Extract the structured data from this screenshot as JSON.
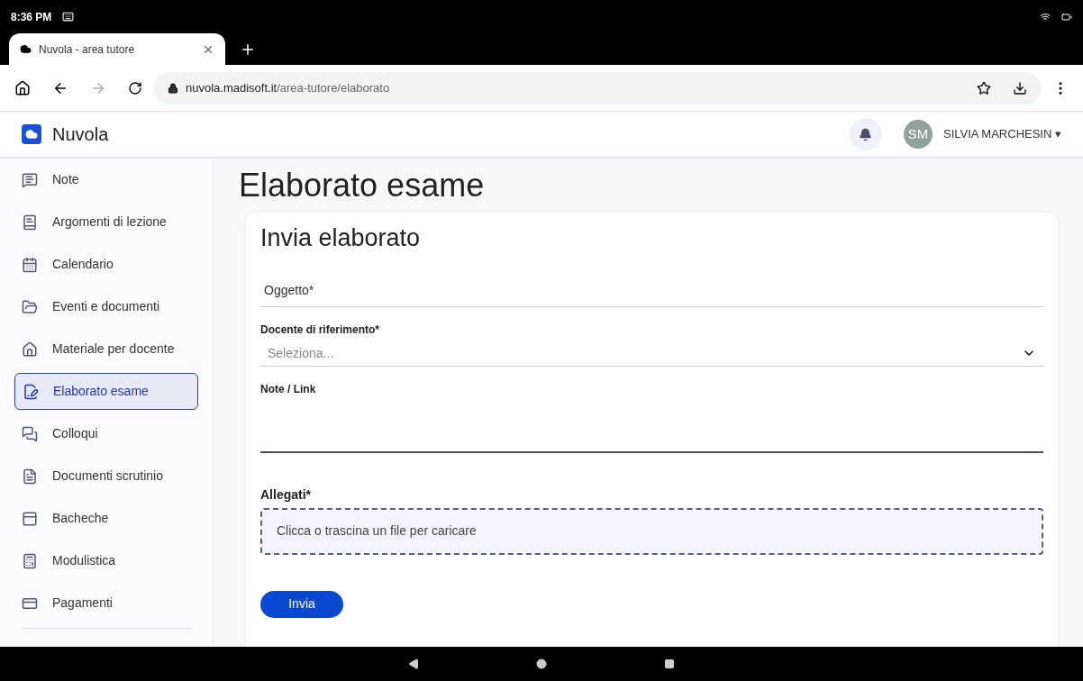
{
  "status_bar": {
    "time": "8:36 PM"
  },
  "browser": {
    "tab_title": "Nuvola - area tutore",
    "url_host": "nuvola.madisoft.it",
    "url_path": "/area-tutore/elaborato"
  },
  "app_header": {
    "brand": "Nuvola",
    "avatar_initials": "SM",
    "user_name": "SILVIA MARCHESIN",
    "user_caret": "▾"
  },
  "sidebar": {
    "items": [
      {
        "label": "Note",
        "selected": false
      },
      {
        "label": "Argomenti di lezione",
        "selected": false
      },
      {
        "label": "Calendario",
        "selected": false
      },
      {
        "label": "Eventi e documenti",
        "selected": false
      },
      {
        "label": "Materiale per docente",
        "selected": false
      },
      {
        "label": "Elaborato esame",
        "selected": true
      },
      {
        "label": "Colloqui",
        "selected": false
      },
      {
        "label": "Documenti scrutinio",
        "selected": false
      },
      {
        "label": "Bacheche",
        "selected": false
      },
      {
        "label": "Modulistica",
        "selected": false
      },
      {
        "label": "Pagamenti",
        "selected": false
      }
    ]
  },
  "page": {
    "title": "Elaborato esame",
    "card": {
      "title": "Invia elaborato",
      "subject": {
        "placeholder": "Oggetto*"
      },
      "teacher": {
        "label": "Docente di riferimento*",
        "placeholder": "Seleziona..."
      },
      "notes": {
        "label": "Note / Link"
      },
      "attachments": {
        "label": "Allegati*",
        "dropzone": "Clicca o trascina un file per caricare"
      },
      "submit": "Invia"
    }
  }
}
